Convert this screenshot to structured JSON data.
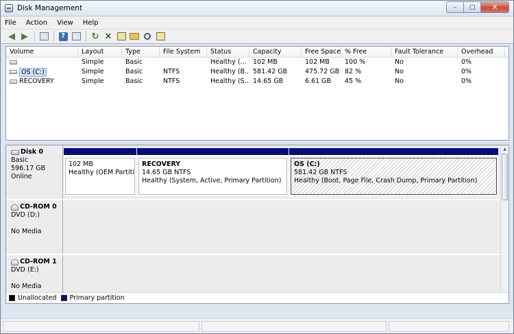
{
  "window": {
    "title": "Disk Management",
    "min": "–",
    "max": "□",
    "close": "✕"
  },
  "menu": [
    "File",
    "Action",
    "View",
    "Help"
  ],
  "toolbar": [
    "back-arrow-icon",
    "forward-arrow-icon",
    "console-tree-icon",
    "help-icon",
    "refresh-icon",
    "delete-icon",
    "properties-icon",
    "open-folder-icon",
    "explore-search-icon",
    "settings-icon"
  ],
  "volume_list": {
    "columns": [
      "Volume",
      "Layout",
      "Type",
      "File System",
      "Status",
      "Capacity",
      "Free Space",
      "% Free",
      "Fault Tolerance",
      "Overhead"
    ],
    "rows": [
      {
        "volume": "",
        "layout": "Simple",
        "type": "Basic",
        "fs": "",
        "status": "Healthy (...",
        "capacity": "102 MB",
        "free": "102 MB",
        "pfree": "100 %",
        "fault": "No",
        "overhead": "0%"
      },
      {
        "volume": "OS (C:)",
        "layout": "Simple",
        "type": "Basic",
        "fs": "NTFS",
        "status": "Healthy (B...",
        "capacity": "581.42 GB",
        "free": "475.72 GB",
        "pfree": "82 %",
        "fault": "No",
        "overhead": "0%"
      },
      {
        "volume": "RECOVERY",
        "layout": "Simple",
        "type": "Basic",
        "fs": "NTFS",
        "status": "Healthy (S...",
        "capacity": "14.65 GB",
        "free": "6.61 GB",
        "pfree": "45 %",
        "fault": "No",
        "overhead": "0%"
      }
    ]
  },
  "disks": [
    {
      "name": "Disk 0",
      "kind": "Basic",
      "size": "596.17 GB",
      "state": "Online",
      "partitions": [
        {
          "name": "",
          "size": "102 MB",
          "status": "Healthy (OEM Partition)"
        },
        {
          "name": "RECOVERY",
          "size": "14.65 GB NTFS",
          "status": "Healthy (System, Active, Primary Partition)"
        },
        {
          "name": "OS  (C:)",
          "size": "581.42 GB NTFS",
          "status": "Healthy (Boot, Page File, Crash Dump, Primary Partition)"
        }
      ]
    },
    {
      "name": "CD-ROM 0",
      "kind": "DVD (D:)",
      "media": "No Media"
    },
    {
      "name": "CD-ROM 1",
      "kind": "DVD (E:)",
      "media": "No Media"
    }
  ],
  "legend": [
    {
      "label": "Unallocated",
      "color": "#000000"
    },
    {
      "label": "Primary partition",
      "color": "#0a0a7c"
    }
  ]
}
